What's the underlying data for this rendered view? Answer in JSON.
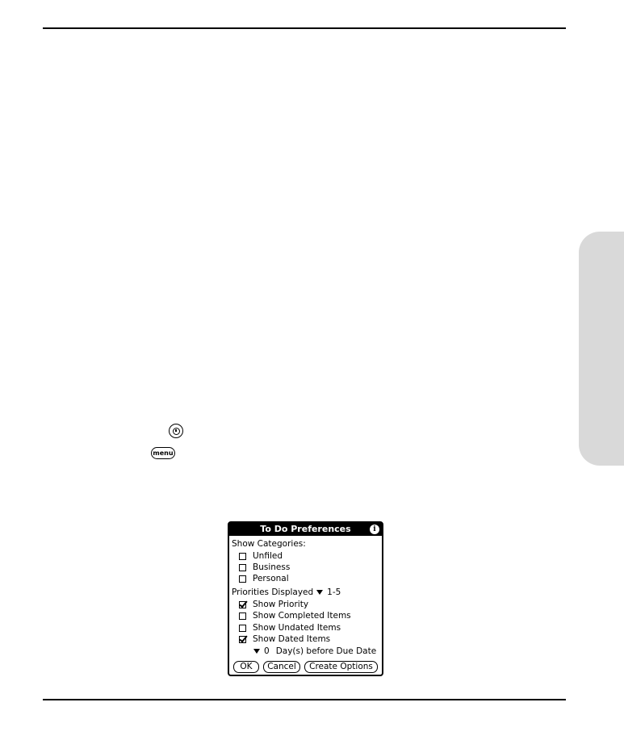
{
  "dialog": {
    "title": "To Do Preferences",
    "show_categories_label": "Show Categories:",
    "categories": [
      {
        "label": "Unfiled",
        "checked": false
      },
      {
        "label": "Business",
        "checked": false
      },
      {
        "label": "Personal",
        "checked": false
      }
    ],
    "priorities_label": "Priorities Displayed",
    "priorities_value": "1-5",
    "options": [
      {
        "label": "Show Priority",
        "checked": true
      },
      {
        "label": "Show Completed Items",
        "checked": false
      },
      {
        "label": "Show Undated Items",
        "checked": false
      },
      {
        "label": "Show Dated Items",
        "checked": true
      }
    ],
    "days_value": "0",
    "days_label": "Day(s) before Due Date",
    "buttons": {
      "ok": "OK",
      "cancel": "Cancel",
      "create_options": "Create Options"
    }
  },
  "icons": {
    "home": "home-icon",
    "menu": "menu-icon",
    "menu_label": "menu",
    "info": "info-icon",
    "info_glyph": "i"
  }
}
